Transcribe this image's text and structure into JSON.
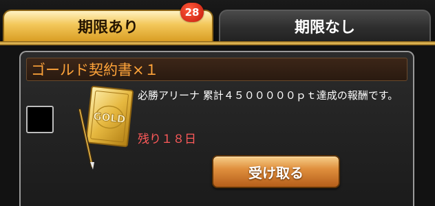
{
  "tabs": [
    {
      "label": "期限あり",
      "active": true,
      "badge": "28"
    },
    {
      "label": "期限なし",
      "active": false
    }
  ],
  "item": {
    "title": "ゴールド契約書×１",
    "description": "必勝アリーナ 累計４５０００００ｐｔ達成の報酬です。",
    "remaining": "残り１８日",
    "receive_label": "受け取る",
    "icon_text": "GOLD"
  },
  "colors": {
    "accent_gold": "#f3c75a",
    "title_orange": "#ffa43a",
    "remaining_red": "#ff5a5a",
    "badge_red": "#c4190b"
  }
}
